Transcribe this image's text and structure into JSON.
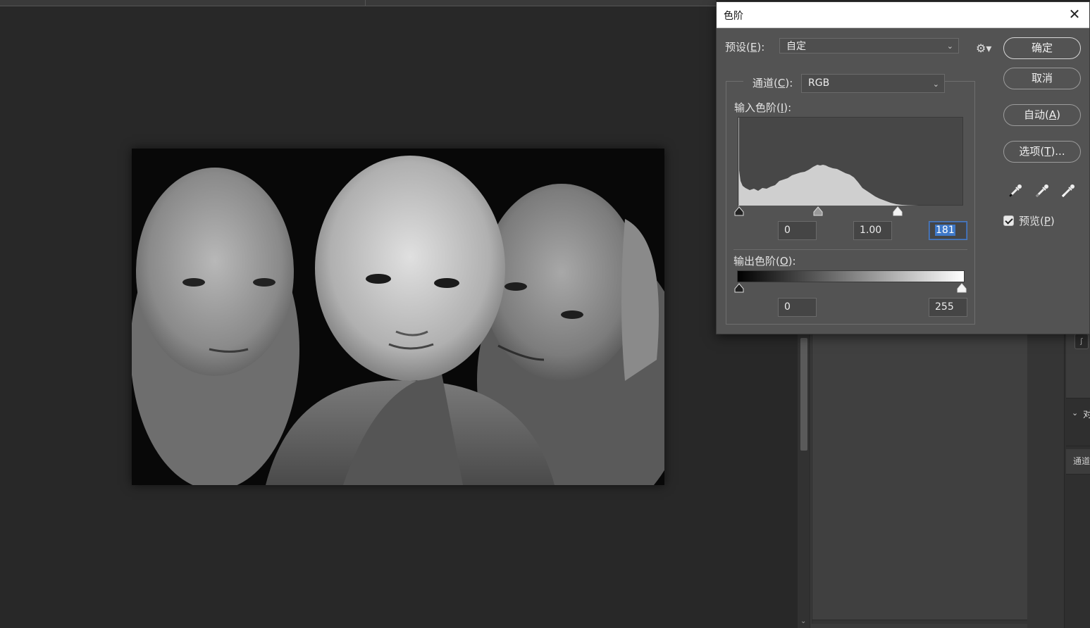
{
  "dialog": {
    "title": "色阶",
    "close_icon": "close-icon",
    "preset": {
      "label": "预设(",
      "key": "E",
      "label_end": "):",
      "value": "自定"
    },
    "channel": {
      "label": "通道(",
      "key": "C",
      "label_end": "):",
      "value": "RGB"
    },
    "input_levels": {
      "label": "输入色阶(",
      "key": "I",
      "label_end": "):",
      "shadow": "0",
      "midtone": "1.00",
      "highlight": "181"
    },
    "output_levels": {
      "label": "输出色阶(",
      "key": "O",
      "label_end": "):",
      "shadow": "0",
      "highlight": "255"
    },
    "buttons": {
      "ok": "确定",
      "cancel": "取消",
      "auto_pre": "自动(",
      "auto_key": "A",
      "auto_post": ")",
      "options_pre": "选项(",
      "options_key": "T",
      "options_post": ")..."
    },
    "preview": {
      "label_pre": "预览(",
      "key": "P",
      "label_post": ")",
      "checked": true
    }
  },
  "side": {
    "panel_text": "对",
    "tab_text": "通道"
  },
  "colors": {
    "dialog_bg": "#535353",
    "canvas_bg": "#282828",
    "focus": "#3e78c8"
  }
}
